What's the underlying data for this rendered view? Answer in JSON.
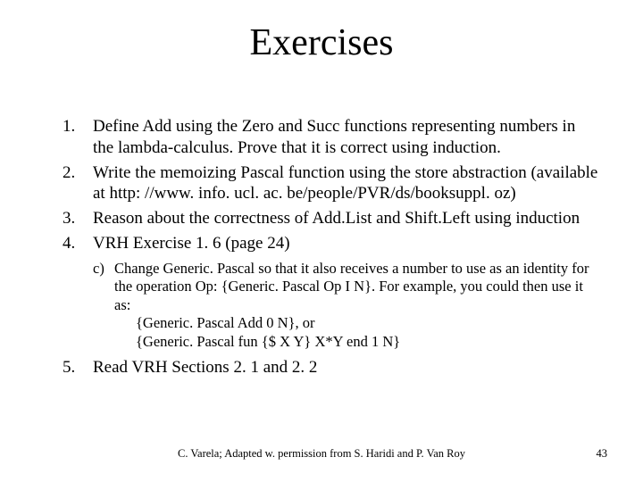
{
  "title": "Exercises",
  "items": [
    {
      "num": "1.",
      "text": "Define Add using the Zero and Succ functions representing numbers in the lambda-calculus.  Prove that it is correct using induction."
    },
    {
      "num": "2.",
      "text": "Write the memoizing Pascal function using the store abstraction (available at http: //www. info. ucl. ac. be/people/PVR/ds/booksuppl. oz)"
    },
    {
      "num": "3.",
      "text": "Reason about the correctness of Add.List and Shift.Left using induction"
    },
    {
      "num": "4.",
      "text": "VRH Exercise 1. 6 (page 24)"
    }
  ],
  "sub": {
    "label": "c)",
    "line1": "Change Generic. Pascal so that it also receives a number to use as an identity for the operation Op: {Generic. Pascal Op I N}.  For example, you could then use it as:",
    "line2": "{Generic. Pascal Add 0 N}, or",
    "line3": "{Generic. Pascal fun {$ X Y} X*Y end 1 N}"
  },
  "item5": {
    "num": "5.",
    "text": "Read VRH Sections 2. 1 and 2. 2"
  },
  "footer": {
    "credit": "C. Varela;  Adapted w. permission from S. Haridi and P. Van Roy",
    "page": "43"
  }
}
